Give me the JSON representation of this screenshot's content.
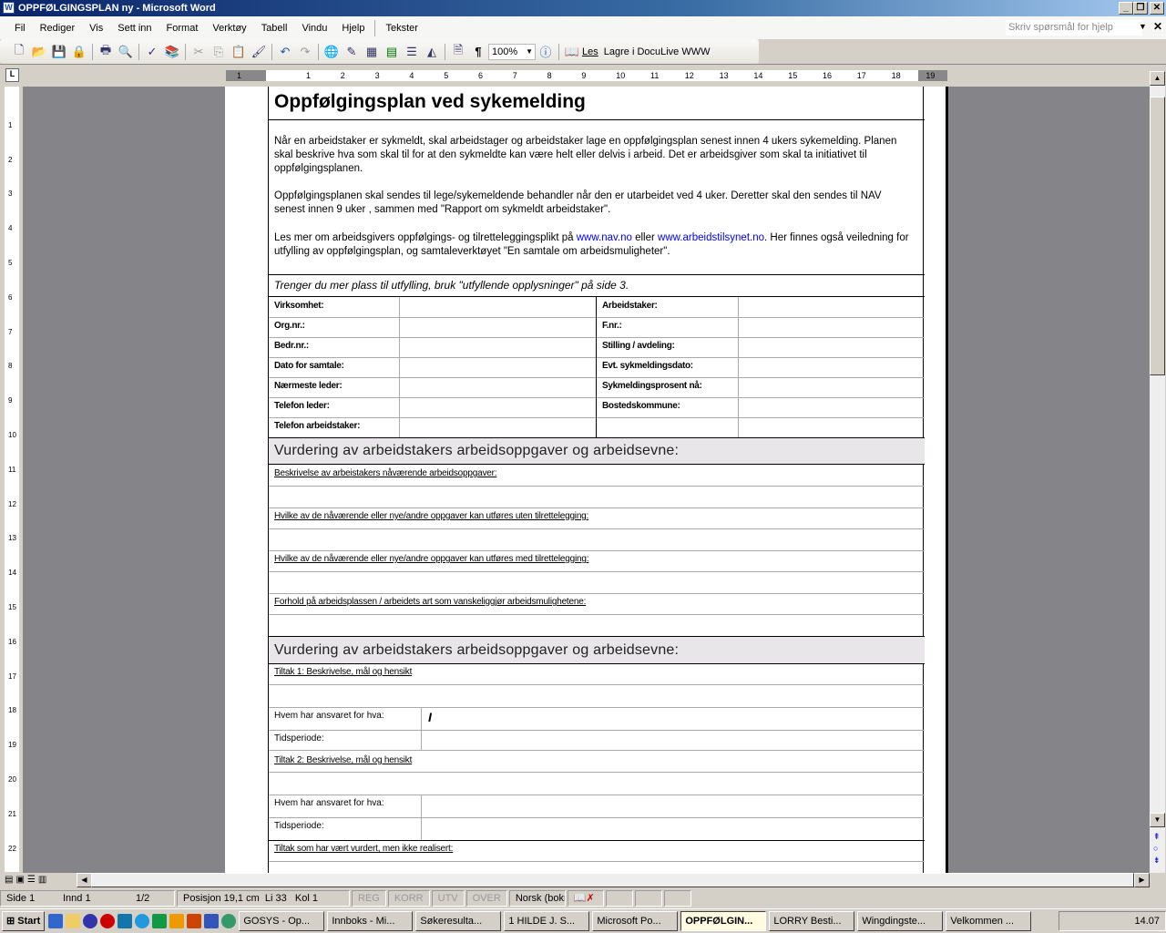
{
  "window": {
    "title": "OPPFØLGINGSPLAN ny - Microsoft Word",
    "minimize": "_",
    "restore": "❐",
    "close": "✕"
  },
  "menu": [
    "Fil",
    "Rediger",
    "Vis",
    "Sett inn",
    "Format",
    "Verktøy",
    "Tabell",
    "Vindu",
    "Hjelp",
    "Tekster"
  ],
  "help_placeholder": "Skriv spørsmål for hjelp",
  "toolbar": {
    "zoom": "100%",
    "read": "Les",
    "save_doculive": "Lagre i DocuLive WWW"
  },
  "ruler_labels": [
    "1",
    "1",
    "2",
    "3",
    "4",
    "5",
    "6",
    "7",
    "8",
    "9",
    "10",
    "11",
    "12",
    "13",
    "14",
    "15",
    "16",
    "17",
    "18",
    "19"
  ],
  "doc": {
    "title": "Oppfølgingsplan ved sykemelding",
    "intro": [
      "Når en arbeidstaker er sykmeldt, skal arbeidstager og arbeidstaker lage en oppfølgingsplan senest innen 4 ukers sykemelding. Planen skal beskrive hva som skal til for at den sykmeldte kan være helt eller delvis i arbeid. Det er arbeidsgiver som skal ta initiativet til oppfølgingsplanen.",
      "Oppfølgingsplanen skal sendes til lege/sykemeldende behandler når den er utarbeidet ved 4 uker. Deretter skal den sendes til NAV senest innen 9 uker , sammen med \"Rapport om sykmeldt arbeidstaker\"."
    ],
    "intro3": {
      "pre": "Les mer om arbeidsgivers oppfølgings- og tilretteleggingsplikt på ",
      "link1": "www.nav.no",
      "mid": " eller ",
      "link2": "www.arbeidstilsynet.no",
      "post": ". Her finnes også veiledning for utfylling av oppfølgingsplan, og samtaleverktøyet \"En samtale om arbeidsmuligheter\"."
    },
    "note": "Trenger du mer plass til utfylling, bruk \"utfyllende opplysninger\" på side 3.",
    "left_labels": [
      "Virksomhet:",
      "Org.nr.:",
      "Bedr.nr.:",
      "Dato for samtale:",
      "Nærmeste leder:",
      "Telefon leder:",
      "Telefon arbeidstaker:"
    ],
    "right_labels": [
      "Arbeidstaker:",
      "F.nr.:",
      "Stilling / avdeling:",
      "Evt. sykmeldingsdato:",
      "Sykmeldingsprosent nå:",
      "Bostedskommune:",
      ""
    ],
    "section1": "Vurdering av arbeidstakers arbeidsoppgaver og arbeidsevne:",
    "questions": [
      "Beskrivelse av arbeistakers nåværende arbeidsoppgaver:",
      "Hvilke av de nåværende eller nye/andre oppgaver kan utføres uten tilrettelegging:",
      "Hvilke av de nåværende eller nye/andre oppgaver kan utføres med tilrettelegging:",
      "Forhold på arbeidsplassen / arbeidets art som vanskeliggjør arbeidsmulighetene:"
    ],
    "section2": "Vurdering av arbeidstakers arbeidsoppgaver og arbeidsevne:",
    "tiltak1": "Tiltak 1:  Beskrivelse, mål og hensikt",
    "tiltak2": "Tiltak 2:  Beskrivelse, mål og hensikt",
    "who": "Hvem har ansvaret for hva:",
    "period": "Tidsperiode:",
    "not_realized": "Tiltak som har vært vurdert, men ikke realisert:"
  },
  "status": {
    "page": "Side 1",
    "section": "Innd 1",
    "pages": "1/2",
    "position": "Posisjon 19,1 cm",
    "line": "Li 33",
    "col": "Kol 1",
    "rec": "REG",
    "trk": "KORR",
    "ext": "UTV",
    "ovr": "OVER",
    "lang": "Norsk (bokm"
  },
  "taskbar": {
    "start": "Start",
    "tasks": [
      "GOSYS - Op...",
      "Innboks - Mi...",
      "Søkeresulta...",
      "1 HILDE J. S...",
      "Microsoft Po...",
      "OPPFØLGIN...",
      "LORRY Besti...",
      "Wingdingste...",
      "Velkommen ..."
    ],
    "active_index": 5,
    "clock": "14.07"
  }
}
